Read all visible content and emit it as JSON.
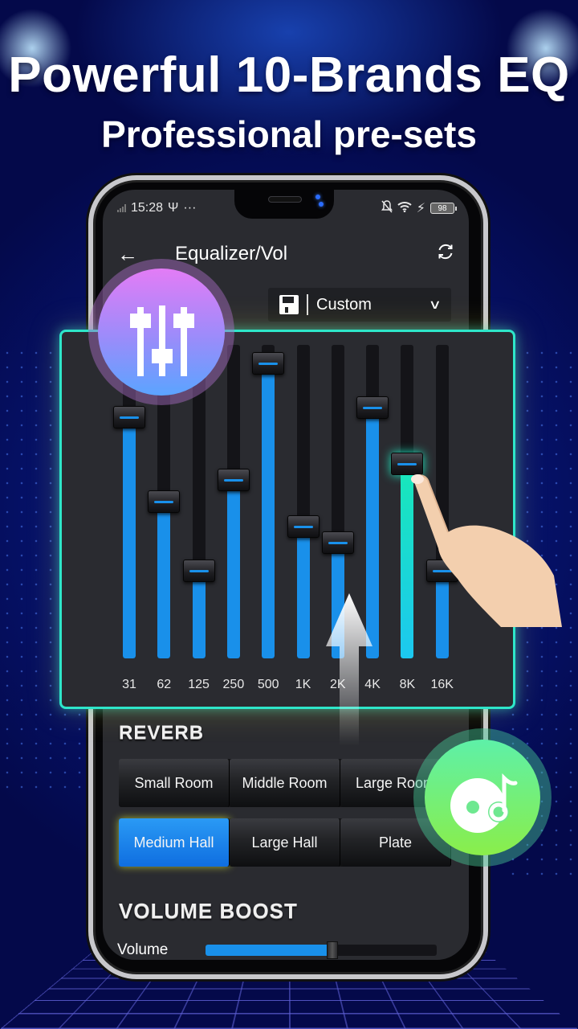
{
  "promo": {
    "headline": "Powerful 10-Brands EQ",
    "subheadline": "Professional pre-sets"
  },
  "status_bar": {
    "time": "15:28",
    "usb_icon": "usb-icon",
    "more": "···",
    "mute_icon": "bell-off-icon",
    "wifi_icon": "wifi-icon",
    "charging_icon": "bolt-icon",
    "battery": "98"
  },
  "app_bar": {
    "back_glyph": "←",
    "title": "Equalizer/Vol",
    "refresh_glyph": "⟳"
  },
  "preset": {
    "save_icon": "floppy-disk-icon",
    "selected": "Custom",
    "chevron": "∨"
  },
  "equalizer": {
    "active_band": "8K",
    "bands": [
      {
        "label": "31",
        "level": 0.77
      },
      {
        "label": "62",
        "level": 0.5
      },
      {
        "label": "125",
        "level": 0.28
      },
      {
        "label": "250",
        "level": 0.57
      },
      {
        "label": "500",
        "level": 0.94
      },
      {
        "label": "1K",
        "level": 0.42
      },
      {
        "label": "2K",
        "level": 0.37
      },
      {
        "label": "4K",
        "level": 0.8
      },
      {
        "label": "8K",
        "level": 0.62
      },
      {
        "label": "16K",
        "level": 0.28
      }
    ]
  },
  "reverb": {
    "title": "REVERB",
    "rows": [
      [
        {
          "label": "Small Room"
        },
        {
          "label": "Middle Room"
        },
        {
          "label": "Large Room"
        }
      ],
      [
        {
          "label": "Medium Hall"
        },
        {
          "label": "Large Hall"
        },
        {
          "label": "Plate"
        }
      ]
    ],
    "selected": "Medium Hall"
  },
  "volume_boost": {
    "title": "VOLUME BOOST",
    "volume_label": "Volume",
    "volume_level": 0.55
  },
  "colors": {
    "accent_blue": "#1990ea",
    "active_teal": "#20e8c0",
    "panel_border": "#2ee6c9"
  }
}
